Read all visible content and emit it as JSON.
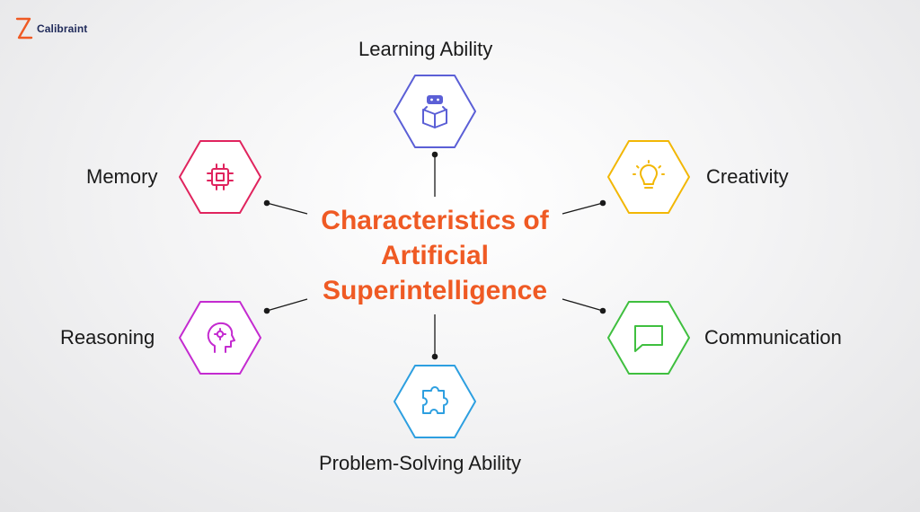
{
  "brand": {
    "name": "Calibraint"
  },
  "title": [
    "Characteristics of",
    "Artificial",
    "Superintelligence"
  ],
  "nodes": [
    {
      "key": "learning",
      "label": "Learning Ability",
      "icon": "robot-reading-icon",
      "color": "#5b5fd6"
    },
    {
      "key": "creativity",
      "label": "Creativity",
      "icon": "lightbulb-icon",
      "color": "#f2b705"
    },
    {
      "key": "communication",
      "label": "Communication",
      "icon": "chat-bubble-icon",
      "color": "#3fbf3f"
    },
    {
      "key": "problem",
      "label": "Problem-Solving Ability",
      "icon": "puzzle-piece-icon",
      "color": "#2d9fe0"
    },
    {
      "key": "reasoning",
      "label": "Reasoning",
      "icon": "brain-gear-icon",
      "color": "#c42bd0"
    },
    {
      "key": "memory",
      "label": "Memory",
      "icon": "chip-icon",
      "color": "#e0245e"
    }
  ],
  "colors": {
    "title": "#ef5a24",
    "connector": "#1a1a1a",
    "text": "#1a1a1a"
  }
}
